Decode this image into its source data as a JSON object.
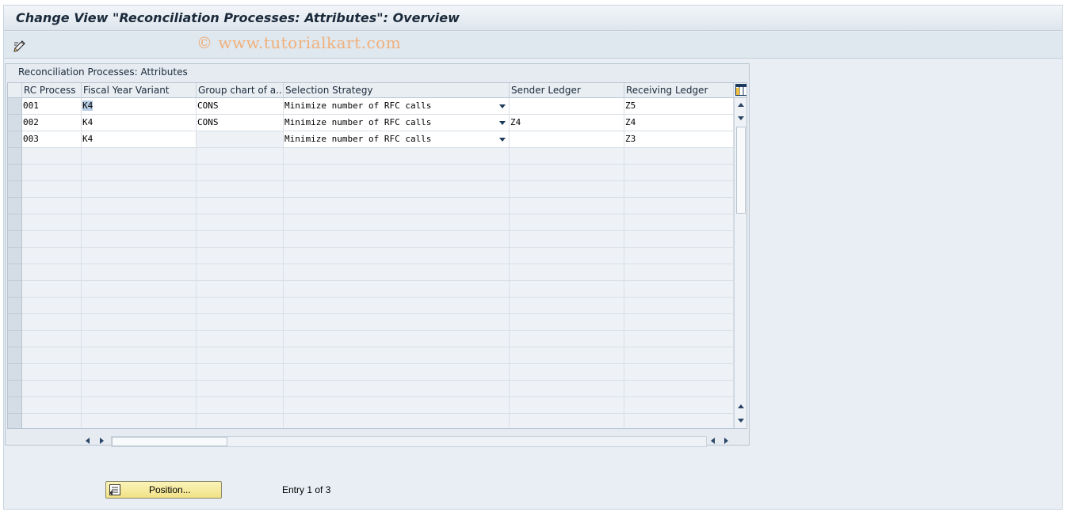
{
  "window": {
    "title": "Change View \"Reconciliation Processes: Attributes\": Overview",
    "watermark": "© www.tutorialkart.com"
  },
  "toolbar": {
    "icons": [
      "display-change-icon"
    ]
  },
  "panel": {
    "title": "Reconciliation Processes: Attributes"
  },
  "table": {
    "columns": [
      "RC Process",
      "Fiscal Year Variant",
      "Group chart of a...",
      "Selection Strategy",
      "Sender Ledger",
      "Receiving Ledger"
    ],
    "rows": [
      {
        "rc_process": "001",
        "fiscal_year_variant": "K4",
        "group_chart": "CONS",
        "selection_strategy": "Minimize number of RFC calls",
        "sender_ledger": "",
        "receiving_ledger": "Z5"
      },
      {
        "rc_process": "002",
        "fiscal_year_variant": "K4",
        "group_chart": "CONS",
        "selection_strategy": "Minimize number of RFC calls",
        "sender_ledger": "Z4",
        "receiving_ledger": "Z4"
      },
      {
        "rc_process": "003",
        "fiscal_year_variant": "K4",
        "group_chart": "",
        "selection_strategy": "Minimize number of RFC calls",
        "sender_ledger": "",
        "receiving_ledger": "Z3"
      }
    ]
  },
  "footer": {
    "position_button": "Position...",
    "entry_text": "Entry 1 of 3"
  },
  "colors": {
    "accent": "#f1e286",
    "header_bg": "#e9eef3",
    "selection": "#b8cde4"
  }
}
